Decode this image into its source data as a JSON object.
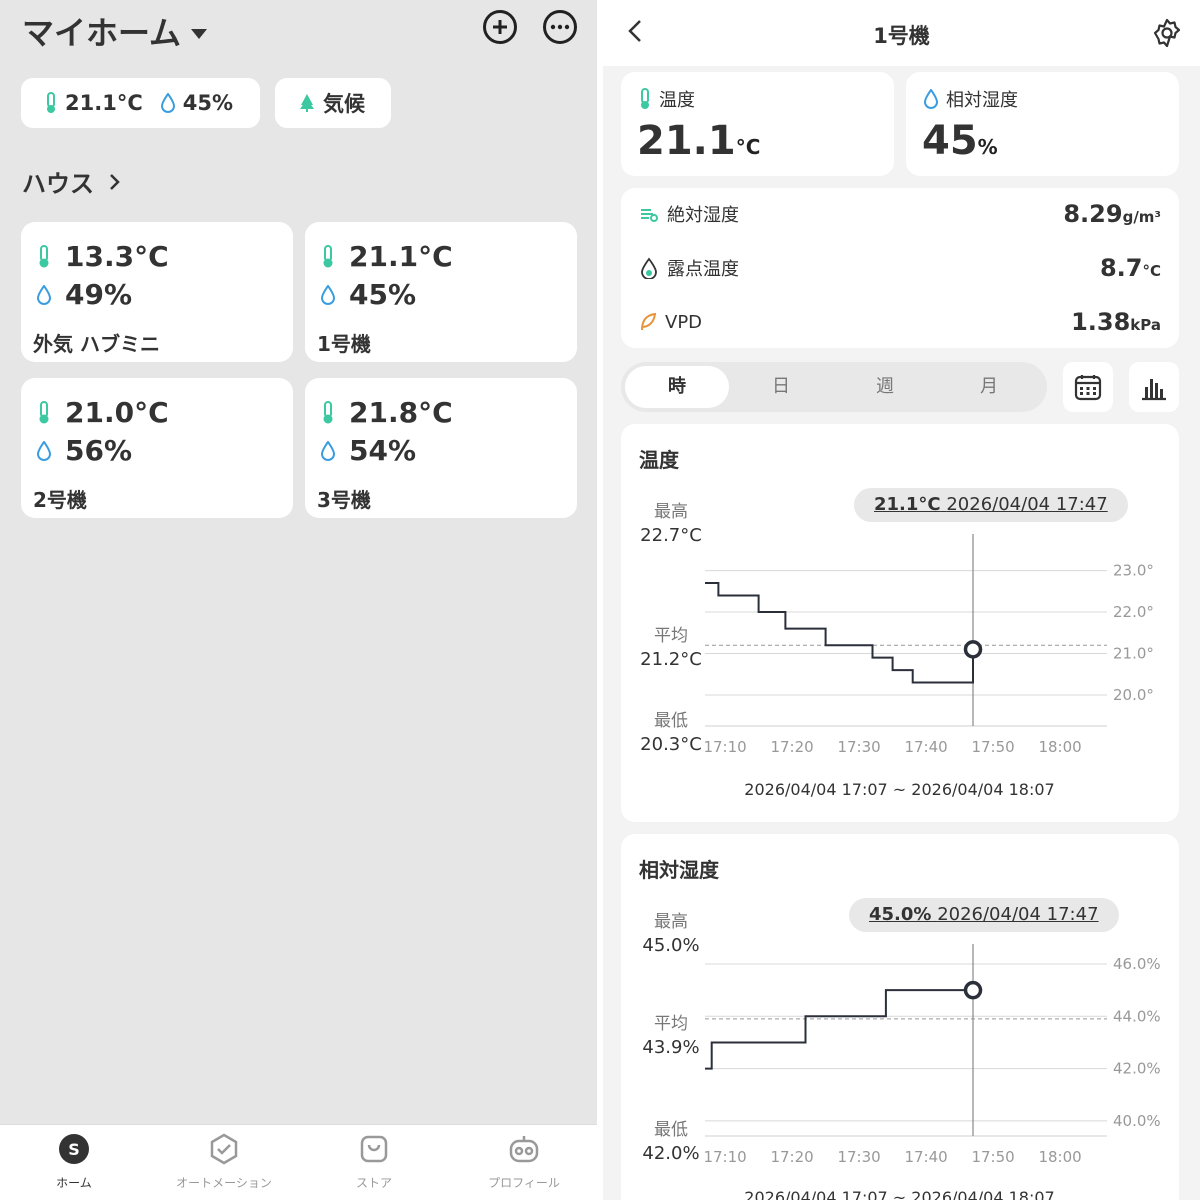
{
  "home": {
    "title": "マイホーム",
    "summary": {
      "temperature": "21.1°C",
      "humidity": "45%"
    },
    "climate_label": "気候",
    "section_label": "ハウス",
    "devices": [
      {
        "temperature": "13.3°C",
        "humidity": "49%",
        "name": "外気 ハブミニ"
      },
      {
        "temperature": "21.1°C",
        "humidity": "45%",
        "name": "1号機"
      },
      {
        "temperature": "21.0°C",
        "humidity": "56%",
        "name": "2号機"
      },
      {
        "temperature": "21.8°C",
        "humidity": "54%",
        "name": "3号機"
      }
    ],
    "tabs": [
      {
        "label": "ホーム",
        "icon": "home-s-icon"
      },
      {
        "label": "オートメーション",
        "icon": "automation-icon"
      },
      {
        "label": "ストア",
        "icon": "store-icon"
      },
      {
        "label": "プロフィール",
        "icon": "profile-icon"
      }
    ]
  },
  "device": {
    "title": "1号機",
    "temperature": {
      "label": "温度",
      "value": "21.1",
      "unit": "°C"
    },
    "humidity": {
      "label": "相対湿度",
      "value": "45",
      "unit": "%"
    },
    "metrics": [
      {
        "label": "絶対湿度",
        "value": "8.29",
        "unit": "g/m³",
        "icon": "abs-humidity-icon"
      },
      {
        "label": "露点温度",
        "value": "8.7",
        "unit": "°C",
        "icon": "dew-point-icon"
      },
      {
        "label": "VPD",
        "value": "1.38",
        "unit": "kPa",
        "icon": "leaf-icon"
      }
    ],
    "periods": [
      "時",
      "日",
      "週",
      "月"
    ],
    "active_period": "時",
    "temp_chart": {
      "title": "温度",
      "max_label": "最高",
      "max_value": "22.7°C",
      "avg_label": "平均",
      "avg_value": "21.2°C",
      "min_label": "最低",
      "min_value": "20.3°C",
      "badge_value": "21.1°C",
      "badge_time": "2026/04/04 17:47",
      "range": "2026/04/04 17:07 ~ 2026/04/04 18:07"
    },
    "hum_chart": {
      "title": "相対湿度",
      "max_label": "最高",
      "max_value": "45.0%",
      "avg_label": "平均",
      "avg_value": "43.9%",
      "min_label": "最低",
      "min_value": "42.0%",
      "badge_value": "45.0%",
      "badge_time": "2026/04/04 17:47",
      "range": "2026/04/04 17:07 ~ 2026/04/04 18:07"
    }
  },
  "chart_data": [
    {
      "type": "line",
      "title": "温度",
      "x_ticks": [
        "17:10",
        "17:20",
        "17:30",
        "17:40",
        "17:50",
        "18:00"
      ],
      "y_ticks": [
        "23.0°",
        "22.0°",
        "21.0°",
        "20.0°"
      ],
      "ylim": [
        19.3,
        23.4
      ],
      "xlim": [
        "17:07",
        "18:07"
      ],
      "average": 21.2,
      "cursor": "17:47",
      "series": [
        {
          "x": [
            "17:07",
            "17:09",
            "17:12",
            "17:15",
            "17:17",
            "17:19",
            "17:22",
            "17:25",
            "17:28",
            "17:32",
            "17:35",
            "17:38",
            "17:46",
            "17:47"
          ],
          "values": [
            22.7,
            22.4,
            22.4,
            22.0,
            22.0,
            21.6,
            21.6,
            21.2,
            21.2,
            20.9,
            20.6,
            20.3,
            20.3,
            21.1
          ]
        }
      ]
    },
    {
      "type": "line",
      "title": "相対湿度",
      "x_ticks": [
        "17:10",
        "17:20",
        "17:30",
        "17:40",
        "17:50",
        "18:00"
      ],
      "y_ticks": [
        "46.0%",
        "44.0%",
        "42.0%",
        "40.0%"
      ],
      "ylim": [
        39.5,
        46.0
      ],
      "xlim": [
        "17:07",
        "18:07"
      ],
      "average": 43.9,
      "cursor": "17:47",
      "series": [
        {
          "x": [
            "17:07",
            "17:08",
            "17:21",
            "17:22",
            "17:33",
            "17:34",
            "17:45",
            "17:46",
            "17:47"
          ],
          "values": [
            42.0,
            43.0,
            43.0,
            44.0,
            44.0,
            45.0,
            45.0,
            45.0,
            45.0
          ]
        }
      ]
    }
  ]
}
